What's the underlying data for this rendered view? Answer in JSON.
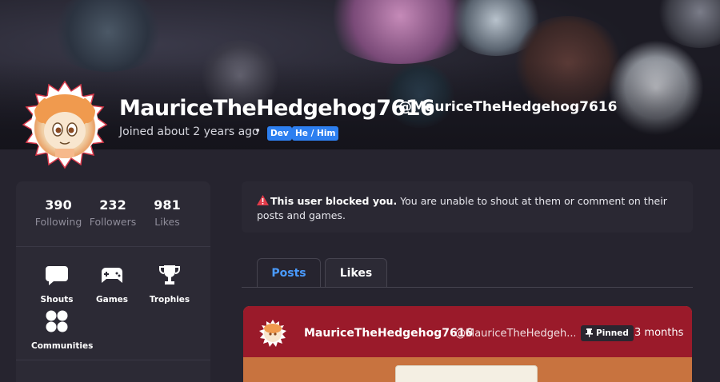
{
  "profile": {
    "display_name": "MauriceTheHedgehog7616",
    "handle": "@MauriceTheHedgehog7616",
    "joined": "Joined about 2 years ago",
    "separator": "•",
    "badges": [
      "Dev",
      "He / Him"
    ]
  },
  "stats": [
    {
      "value": "390",
      "label": "Following"
    },
    {
      "value": "232",
      "label": "Followers"
    },
    {
      "value": "981",
      "label": "Likes"
    }
  ],
  "menu": [
    {
      "label": "Shouts",
      "icon": "speech-bubble-icon"
    },
    {
      "label": "Games",
      "icon": "gamepad-icon"
    },
    {
      "label": "Trophies",
      "icon": "trophy-icon"
    },
    {
      "label": "Communities",
      "icon": "communities-icon"
    }
  ],
  "alert": {
    "icon": "warning-icon",
    "title": "This user blocked you.",
    "text": "You are unable to shout at them or comment on their posts and games."
  },
  "tabs": [
    {
      "label": "Posts",
      "active": true
    },
    {
      "label": "Likes",
      "active": false
    }
  ],
  "post": {
    "author": "MauriceTheHedgehog7616",
    "handle": "@MauriceTheHedgeh...",
    "pinned_label": "Pinned",
    "time": "3 months"
  },
  "colors": {
    "background": "#26242f",
    "panel": "#2c2a35",
    "accent_blue": "#2d7ff0",
    "tab_active": "#4a9bff",
    "post_header": "#9a1a2a",
    "warning": "#e23b4a"
  }
}
